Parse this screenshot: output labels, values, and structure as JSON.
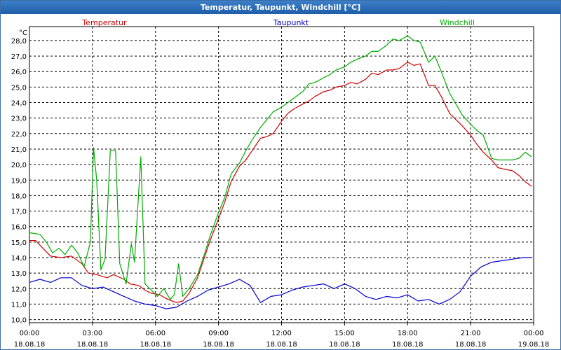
{
  "window": {
    "title": "Temperatur, Taupunkt, Windchill [°C]"
  },
  "chart_data": {
    "type": "line",
    "title": "Temperatur, Taupunkt, Windchill [°C]",
    "ylabel": "°C",
    "xlabel": "",
    "ylim": [
      9.8,
      28.9
    ],
    "xlim": [
      0,
      24
    ],
    "grid": true,
    "legend_placement": "top",
    "y_ticks": [
      "10,0",
      "11,0",
      "12,0",
      "13,0",
      "14,0",
      "15,0",
      "16,0",
      "17,0",
      "18,0",
      "19,0",
      "20,0",
      "21,0",
      "22,0",
      "23,0",
      "24,0",
      "25,0",
      "26,0",
      "27,0",
      "28,0"
    ],
    "x_ticks": [
      {
        "time": "00:00",
        "date": "18.08.18"
      },
      {
        "time": "03:00",
        "date": "18.08.18"
      },
      {
        "time": "06:00",
        "date": "18.08.18"
      },
      {
        "time": "09:00",
        "date": "18.08.18"
      },
      {
        "time": "12:00",
        "date": "18.08.18"
      },
      {
        "time": "15:00",
        "date": "18.08.18"
      },
      {
        "time": "18:00",
        "date": "18.08.18"
      },
      {
        "time": "21:00",
        "date": "18.08.18"
      },
      {
        "time": "00:00",
        "date": "19.08.18"
      }
    ],
    "series": [
      {
        "name": "Temperatur",
        "color": "#cc0000",
        "points": [
          [
            0,
            15.1
          ],
          [
            0.3,
            15.1
          ],
          [
            0.5,
            14.8
          ],
          [
            1,
            14.1
          ],
          [
            1.5,
            14.0
          ],
          [
            2,
            14.1
          ],
          [
            2.5,
            13.6
          ],
          [
            2.8,
            13.0
          ],
          [
            3.2,
            12.9
          ],
          [
            3.7,
            12.7
          ],
          [
            4,
            12.9
          ],
          [
            4.5,
            12.6
          ],
          [
            4.8,
            12.3
          ],
          [
            5.2,
            12.2
          ],
          [
            5.5,
            11.9
          ],
          [
            5.8,
            11.7
          ],
          [
            6.2,
            11.6
          ],
          [
            6.6,
            11.3
          ],
          [
            7,
            11.1
          ],
          [
            7.3,
            11.2
          ],
          [
            7.6,
            11.7
          ],
          [
            8,
            12.7
          ],
          [
            8.3,
            13.9
          ],
          [
            8.6,
            15.1
          ],
          [
            9,
            16.5
          ],
          [
            9.3,
            17.6
          ],
          [
            9.6,
            18.9
          ],
          [
            10,
            19.9
          ],
          [
            10.3,
            20.3
          ],
          [
            10.6,
            20.9
          ],
          [
            11,
            21.7
          ],
          [
            11.3,
            21.8
          ],
          [
            11.6,
            22.0
          ],
          [
            12,
            22.8
          ],
          [
            12.3,
            23.3
          ],
          [
            12.6,
            23.6
          ],
          [
            13,
            23.9
          ],
          [
            13.3,
            24.1
          ],
          [
            13.6,
            24.4
          ],
          [
            14,
            24.7
          ],
          [
            14.3,
            24.8
          ],
          [
            14.6,
            25.0
          ],
          [
            15,
            25.1
          ],
          [
            15.3,
            25.3
          ],
          [
            15.6,
            25.2
          ],
          [
            16,
            25.5
          ],
          [
            16.3,
            25.9
          ],
          [
            16.6,
            25.8
          ],
          [
            17,
            26.1
          ],
          [
            17.3,
            26.1
          ],
          [
            17.6,
            26.2
          ],
          [
            18,
            26.6
          ],
          [
            18.3,
            26.4
          ],
          [
            18.6,
            26.5
          ],
          [
            19,
            25.1
          ],
          [
            19.3,
            25.1
          ],
          [
            19.6,
            24.4
          ],
          [
            20,
            23.3
          ],
          [
            20.3,
            22.9
          ],
          [
            20.6,
            22.5
          ],
          [
            21,
            21.9
          ],
          [
            21.3,
            21.3
          ],
          [
            21.6,
            20.8
          ],
          [
            22,
            20.3
          ],
          [
            22.3,
            19.8
          ],
          [
            22.6,
            19.7
          ],
          [
            23,
            19.6
          ],
          [
            23.3,
            19.3
          ],
          [
            23.6,
            18.9
          ],
          [
            23.9,
            18.6
          ]
        ]
      },
      {
        "name": "Taupunkt",
        "color": "#0000cc",
        "points": [
          [
            0,
            12.4
          ],
          [
            0.5,
            12.6
          ],
          [
            1,
            12.4
          ],
          [
            1.5,
            12.7
          ],
          [
            2,
            12.7
          ],
          [
            2.5,
            12.2
          ],
          [
            3,
            12.0
          ],
          [
            3.5,
            12.1
          ],
          [
            4,
            11.8
          ],
          [
            4.5,
            11.5
          ],
          [
            5,
            11.2
          ],
          [
            5.5,
            11.0
          ],
          [
            6,
            10.9
          ],
          [
            6.5,
            10.7
          ],
          [
            7,
            10.8
          ],
          [
            7.5,
            11.2
          ],
          [
            8,
            11.5
          ],
          [
            8.5,
            11.9
          ],
          [
            9,
            12.1
          ],
          [
            9.5,
            12.3
          ],
          [
            10,
            12.6
          ],
          [
            10.5,
            12.2
          ],
          [
            11,
            11.1
          ],
          [
            11.5,
            11.5
          ],
          [
            12,
            11.6
          ],
          [
            12.5,
            11.9
          ],
          [
            13,
            12.1
          ],
          [
            13.5,
            12.2
          ],
          [
            14,
            12.3
          ],
          [
            14.5,
            12.0
          ],
          [
            15,
            12.3
          ],
          [
            15.5,
            12.0
          ],
          [
            16,
            11.5
          ],
          [
            16.5,
            11.3
          ],
          [
            17,
            11.5
          ],
          [
            17.5,
            11.4
          ],
          [
            18,
            11.6
          ],
          [
            18.5,
            11.2
          ],
          [
            19,
            11.3
          ],
          [
            19.5,
            11.0
          ],
          [
            20,
            11.3
          ],
          [
            20.5,
            11.8
          ],
          [
            21,
            12.8
          ],
          [
            21.5,
            13.4
          ],
          [
            22,
            13.7
          ],
          [
            22.5,
            13.8
          ],
          [
            23,
            13.9
          ],
          [
            23.5,
            14.0
          ],
          [
            23.9,
            14.0
          ]
        ]
      },
      {
        "name": "Windchill",
        "color": "#00aa00",
        "points": [
          [
            0,
            15.6
          ],
          [
            0.5,
            15.5
          ],
          [
            0.8,
            15.0
          ],
          [
            1.1,
            14.3
          ],
          [
            1.4,
            14.6
          ],
          [
            1.7,
            14.2
          ],
          [
            2,
            14.8
          ],
          [
            2.3,
            14.3
          ],
          [
            2.6,
            13.4
          ],
          [
            2.9,
            15.0
          ],
          [
            3.05,
            21.1
          ],
          [
            3.2,
            19.0
          ],
          [
            3.4,
            13.2
          ],
          [
            3.6,
            13.9
          ],
          [
            3.85,
            20.9
          ],
          [
            4.1,
            20.9
          ],
          [
            4.3,
            13.6
          ],
          [
            4.6,
            12.3
          ],
          [
            4.85,
            14.9
          ],
          [
            5.0,
            13.7
          ],
          [
            5.3,
            20.5
          ],
          [
            5.5,
            12.3
          ],
          [
            5.8,
            11.9
          ],
          [
            6.1,
            11.5
          ],
          [
            6.4,
            12.0
          ],
          [
            6.7,
            11.3
          ],
          [
            6.9,
            11.6
          ],
          [
            7.1,
            13.6
          ],
          [
            7.3,
            11.5
          ],
          [
            7.6,
            12.0
          ],
          [
            8,
            12.9
          ],
          [
            8.3,
            14.1
          ],
          [
            8.6,
            15.4
          ],
          [
            9,
            16.9
          ],
          [
            9.3,
            17.9
          ],
          [
            9.6,
            19.4
          ],
          [
            10,
            20.1
          ],
          [
            10.3,
            20.9
          ],
          [
            10.6,
            21.6
          ],
          [
            11,
            22.4
          ],
          [
            11.3,
            22.9
          ],
          [
            11.6,
            23.4
          ],
          [
            12,
            23.7
          ],
          [
            12.3,
            24.0
          ],
          [
            12.6,
            24.3
          ],
          [
            13,
            24.7
          ],
          [
            13.3,
            25.2
          ],
          [
            13.6,
            25.3
          ],
          [
            14,
            25.6
          ],
          [
            14.3,
            25.8
          ],
          [
            14.6,
            26.1
          ],
          [
            15,
            26.3
          ],
          [
            15.3,
            26.6
          ],
          [
            15.6,
            26.8
          ],
          [
            16,
            27.0
          ],
          [
            16.3,
            27.3
          ],
          [
            16.6,
            27.3
          ],
          [
            17,
            27.7
          ],
          [
            17.3,
            28.1
          ],
          [
            17.6,
            28.0
          ],
          [
            18,
            28.3
          ],
          [
            18.3,
            28.0
          ],
          [
            18.6,
            27.9
          ],
          [
            19,
            26.6
          ],
          [
            19.3,
            27.0
          ],
          [
            19.6,
            26.0
          ],
          [
            20,
            24.6
          ],
          [
            20.3,
            23.9
          ],
          [
            20.6,
            23.2
          ],
          [
            21,
            22.6
          ],
          [
            21.3,
            22.2
          ],
          [
            21.6,
            21.9
          ],
          [
            22,
            20.4
          ],
          [
            22.3,
            20.3
          ],
          [
            22.6,
            20.3
          ],
          [
            23,
            20.3
          ],
          [
            23.3,
            20.4
          ],
          [
            23.6,
            20.8
          ],
          [
            23.9,
            20.5
          ]
        ]
      }
    ]
  }
}
